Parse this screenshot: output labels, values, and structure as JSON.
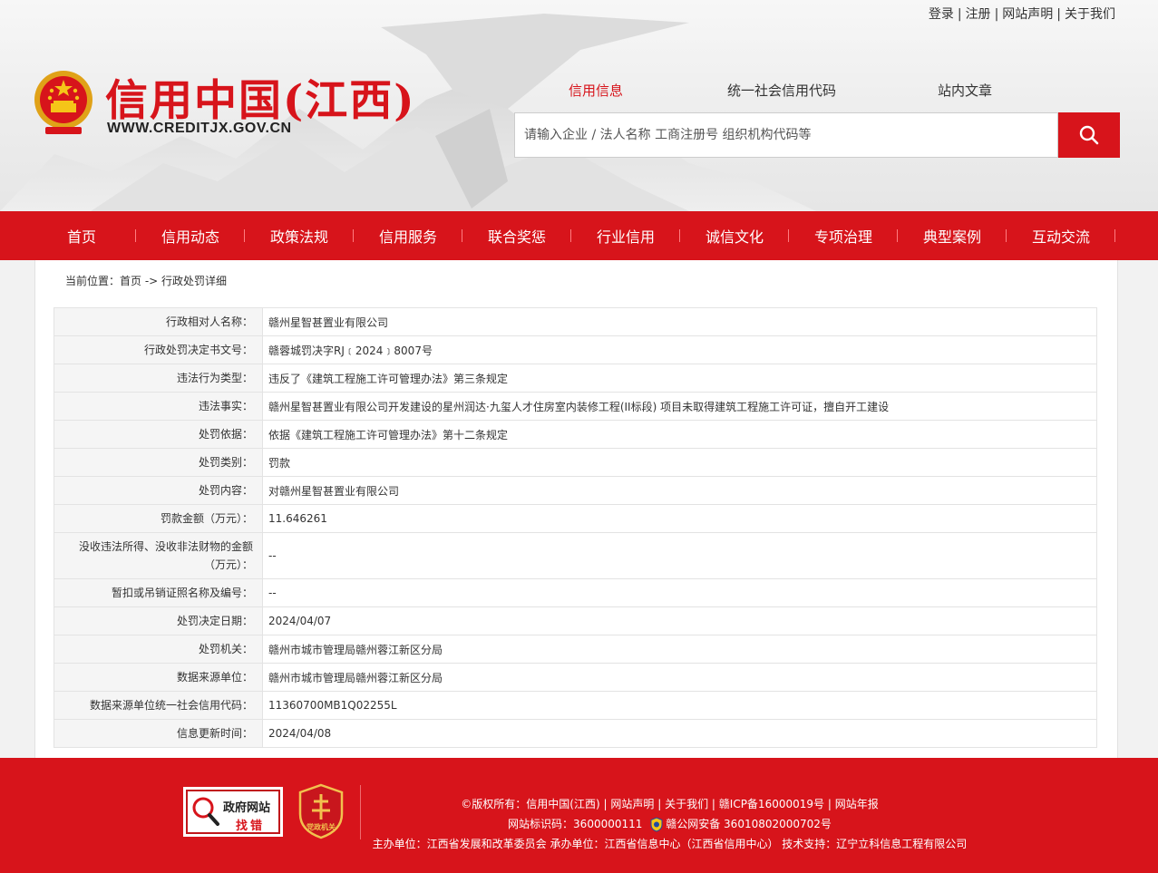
{
  "top_links": [
    "登录",
    "注册",
    "网站声明",
    "关于我们"
  ],
  "top_sep": "|",
  "logo": {
    "title": "信用中国(江西)",
    "url": "WWW.CREDITJX.GOV.CN"
  },
  "search": {
    "tabs": [
      "信用信息",
      "统一社会信用代码",
      "站内文章"
    ],
    "active_tab": 0,
    "placeholder": "请输入企业 / 法人名称 工商注册号 组织机构代码等",
    "button_icon": "search-icon"
  },
  "nav": [
    "首页",
    "信用动态",
    "政策法规",
    "信用服务",
    "联合奖惩",
    "行业信用",
    "诚信文化",
    "专项治理",
    "典型案例",
    "互动交流"
  ],
  "breadcrumb": {
    "prefix": "当前位置：",
    "home": "首页",
    "arrow": " -> ",
    "current": "行政处罚详细"
  },
  "detail_rows": [
    {
      "label": "行政相对人名称：",
      "value": "赣州星智甚置业有限公司"
    },
    {
      "label": "行政处罚决定书文号：",
      "value": "赣蓉城罚决字RJ﹝2024﹞8007号"
    },
    {
      "label": "违法行为类型：",
      "value": "违反了《建筑工程施工许可管理办法》第三条规定"
    },
    {
      "label": "违法事实：",
      "value": "赣州星智甚置业有限公司开发建设的星州润达·九玺人才住房室内装修工程(II标段) 项目未取得建筑工程施工许可证，擅自开工建设"
    },
    {
      "label": "处罚依据：",
      "value": "依据《建筑工程施工许可管理办法》第十二条规定"
    },
    {
      "label": "处罚类别：",
      "value": "罚款"
    },
    {
      "label": "处罚内容：",
      "value": "对赣州星智甚置业有限公司"
    },
    {
      "label": "罚款金额（万元）：",
      "value": "11.646261"
    },
    {
      "label": "没收违法所得、没收非法财物的金额（万元）：",
      "value": "--"
    },
    {
      "label": "暂扣或吊销证照名称及编号：",
      "value": "--"
    },
    {
      "label": "处罚决定日期：",
      "value": "2024/04/07"
    },
    {
      "label": "处罚机关：",
      "value": "赣州市城市管理局赣州蓉江新区分局"
    },
    {
      "label": "数据来源单位：",
      "value": "赣州市城市管理局赣州蓉江新区分局"
    },
    {
      "label": "数据来源单位统一社会信用代码：",
      "value": "11360700MB1Q02255L"
    },
    {
      "label": "信息更新时间：",
      "value": "2024/04/08"
    }
  ],
  "footer": {
    "badge_gov": {
      "line1": "政府网站",
      "line2": "找错"
    },
    "badge_party": "党政机关",
    "line1": {
      "copyright": "©版权所有：信用中国(江西)",
      "links": [
        "网站声明",
        "关于我们",
        "赣ICP备16000019号",
        "网站年报"
      ]
    },
    "line2": {
      "site_id": "网站标识码：3600000111",
      "police": "赣公网安备 36010802000702号"
    },
    "line3": "主办单位：江西省发展和改革委员会  承办单位：江西省信息中心（江西省信用中心）  技术支持：辽宁立科信息工程有限公司",
    "sep": "|"
  },
  "colors": {
    "brand_red": "#d7141b",
    "label_bg": "#f5f5f5",
    "border": "#e3e3e3"
  }
}
